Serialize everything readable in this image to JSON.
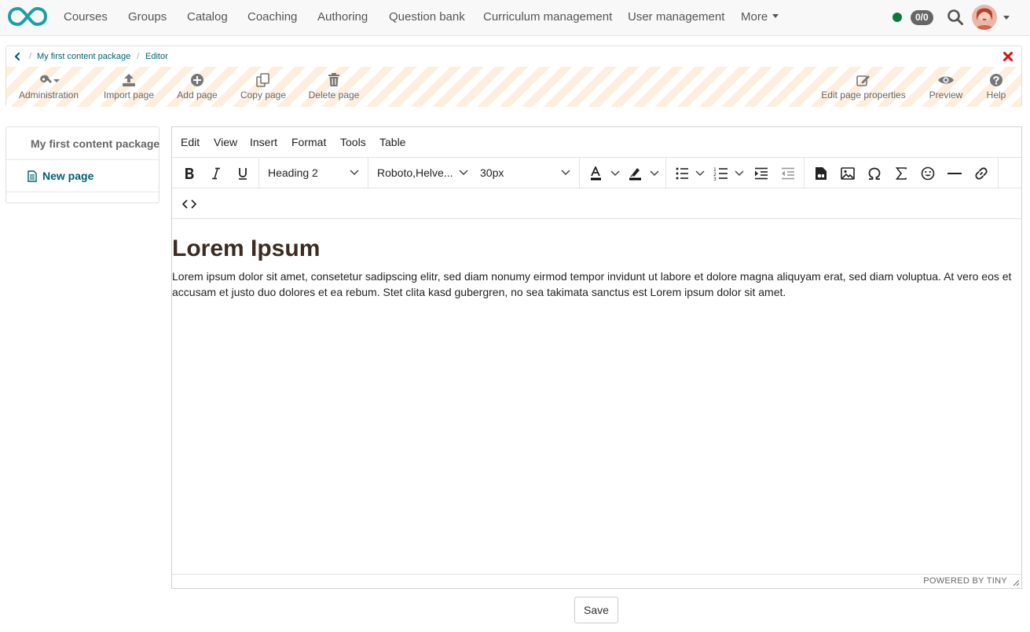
{
  "topnav": {
    "items": [
      "Courses",
      "Groups",
      "Catalog",
      "Coaching",
      "Authoring",
      "Question bank",
      "Curriculum management",
      "User management"
    ],
    "more_label": "More",
    "badge": "0/0",
    "status_color": "#0b7a3e",
    "logo_color": "#1aa1a8"
  },
  "breadcrumb": {
    "items": [
      "My first content package",
      "Editor"
    ],
    "separator": "/"
  },
  "tools": {
    "administration": "Administration",
    "import_page": "Import page",
    "add_page": "Add page",
    "copy_page": "Copy page",
    "delete_page": "Delete page",
    "edit_page_properties": "Edit page properties",
    "preview": "Preview",
    "help": "Help"
  },
  "tree": {
    "root": "My first content package",
    "page": "New page"
  },
  "editor": {
    "menu": [
      "Edit",
      "View",
      "Insert",
      "Format",
      "Tools",
      "Table"
    ],
    "block_format": "Heading 2",
    "font_family": "Roboto,Helve...",
    "font_size": "30px",
    "heading": "Lorem Ipsum",
    "paragraph": "Lorem ipsum dolor sit amet, consetetur sadipscing elitr, sed diam nonumy eirmod tempor invidunt ut labore et dolore magna aliquyam erat, sed diam voluptua. At vero eos et accusam et justo duo dolores et ea rebum. Stet clita kasd gubergren, no sea takimata sanctus est Lorem ipsum dolor sit amet.",
    "powered_by": "POWERED BY TINY"
  },
  "save_label": "Save"
}
